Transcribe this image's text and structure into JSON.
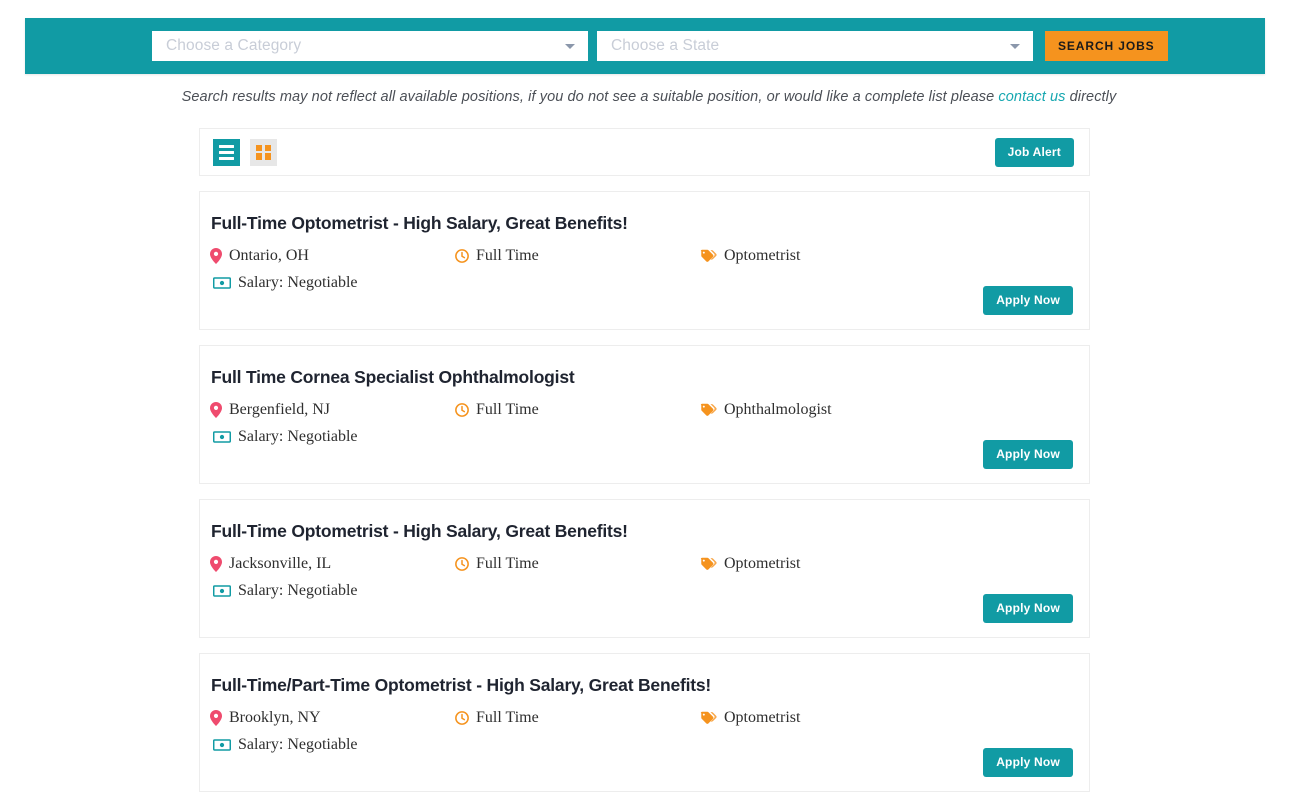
{
  "search": {
    "category_placeholder": "Choose a Category",
    "state_placeholder": "Choose a State",
    "search_button": "SEARCH JOBS",
    "bar_color": "#119ba4",
    "button_color": "#f5931e"
  },
  "notice": {
    "text_before": "Search results may not reflect all available positions, if you do not see a suitable position, or would like a complete list please ",
    "link_text": "contact us",
    "text_after": " directly"
  },
  "toolbar": {
    "list_view_label": "list-view",
    "grid_view_label": "grid-view",
    "job_alert_label": "Job Alert",
    "active_view": "list"
  },
  "jobs": [
    {
      "title": "Full-Time Optometrist - High Salary, Great Benefits!",
      "location": "Ontario, OH",
      "type": "Full Time",
      "category": "Optometrist",
      "salary": "Salary: Negotiable",
      "apply_label": "Apply Now"
    },
    {
      "title": "Full Time Cornea Specialist Ophthalmologist",
      "location": "Bergenfield, NJ",
      "type": "Full Time",
      "category": "Ophthalmologist",
      "salary": "Salary: Negotiable",
      "apply_label": "Apply Now"
    },
    {
      "title": "Full-Time Optometrist - High Salary, Great Benefits!",
      "location": "Jacksonville, IL",
      "type": "Full Time",
      "category": "Optometrist",
      "salary": "Salary: Negotiable",
      "apply_label": "Apply Now"
    },
    {
      "title": "Full-Time/Part-Time Optometrist - High Salary, Great Benefits!",
      "location": "Brooklyn, NY",
      "type": "Full Time",
      "category": "Optometrist",
      "salary": "Salary: Negotiable",
      "apply_label": "Apply Now"
    }
  ],
  "icons": {
    "location": "map-pin-icon",
    "type": "clock-icon",
    "category": "tag-icon",
    "salary": "money-icon",
    "caret": "chevron-down-icon"
  },
  "colors": {
    "teal": "#119ba4",
    "orange": "#f5931e",
    "pin_pink": "#ef4b6e",
    "link_teal": "#16a7b0"
  }
}
